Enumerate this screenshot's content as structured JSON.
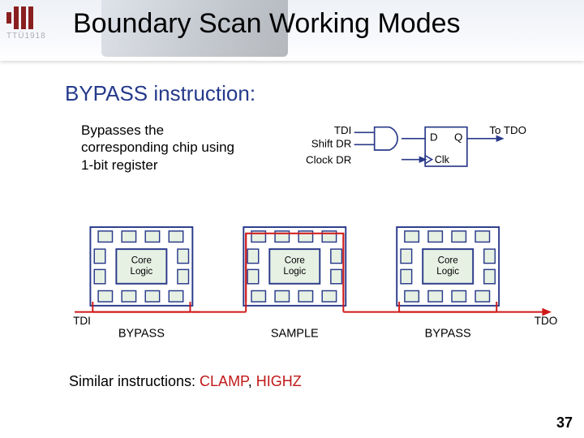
{
  "logo_text": "TTÜ1918",
  "title": "Boundary Scan Working Modes",
  "subtitle": "BYPASS instruction:",
  "description": "Bypasses the corresponding chip using 1-bit register",
  "flipflop": {
    "tdi": "TDI",
    "shiftdr": "Shift DR",
    "clockdr": "Clock DR",
    "d": "D",
    "q": "Q",
    "clk": "Clk",
    "totdo": "To TDO"
  },
  "core": "Core\nLogic",
  "chips": {
    "tdi": "TDI",
    "tdo": "TDO",
    "labels": [
      "BYPASS",
      "SAMPLE",
      "BYPASS"
    ]
  },
  "bottom": {
    "prefix": "Similar instructions: ",
    "a": "CLAMP",
    "b": "HIGHZ"
  },
  "page": "37"
}
